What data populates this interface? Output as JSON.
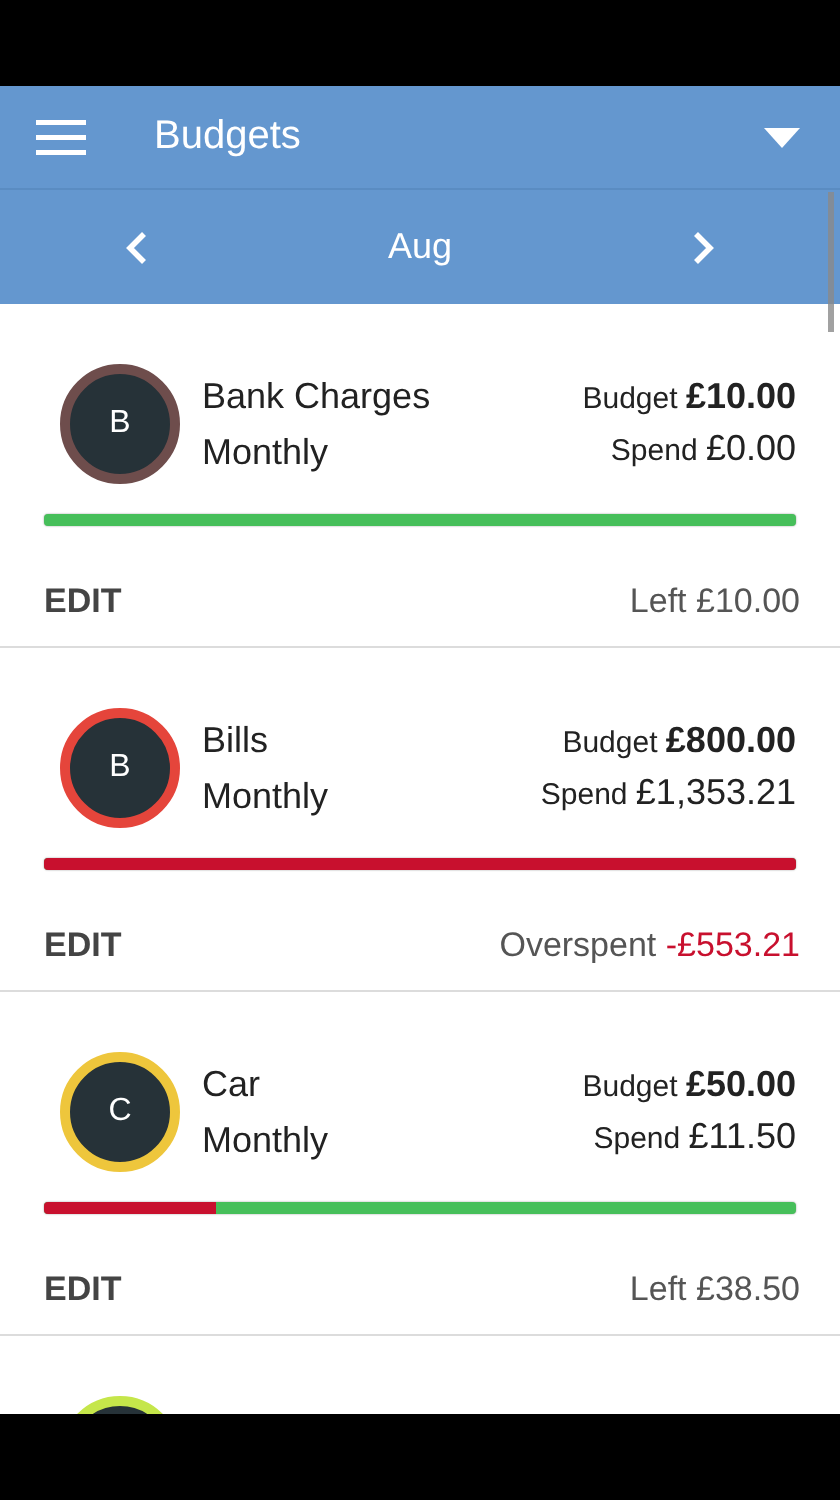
{
  "app_bar": {
    "title": "Budgets"
  },
  "month_bar": {
    "month": "Aug"
  },
  "budgets": [
    {
      "kind": "budget",
      "initial": "B",
      "name": "Bank Charges",
      "period": "Monthly",
      "color": "#6e4d4c",
      "budget_label": "Budget",
      "budget": "£10.00",
      "spend_label": "Spend",
      "spend": "£0.00",
      "level": 0,
      "edit": "EDIT",
      "overspent": false,
      "status_label": "Left",
      "remaining": "£10.00"
    },
    {
      "kind": "budget",
      "initial": "B",
      "name": "Bills",
      "period": "Monthly",
      "color": "#e5453b",
      "budget_label": "Budget",
      "budget": "£800.00",
      "spend_label": "Spend",
      "spend": "£1,353.21",
      "level": 1,
      "edit": "EDIT",
      "overspent": true,
      "status_label": "Overspent",
      "remaining": "-£553.21"
    },
    {
      "kind": "budget",
      "initial": "C",
      "name": "Car",
      "period": "Monthly",
      "color": "#eec63c",
      "budget_label": "Budget",
      "budget": "£50.00",
      "spend_label": "Spend",
      "spend": "£11.50",
      "level": 0.23,
      "edit": "EDIT",
      "overspent": false,
      "status_label": "Left",
      "remaining": "£38.50"
    },
    {
      "kind": "partial",
      "color": "#c5e64a"
    }
  ]
}
